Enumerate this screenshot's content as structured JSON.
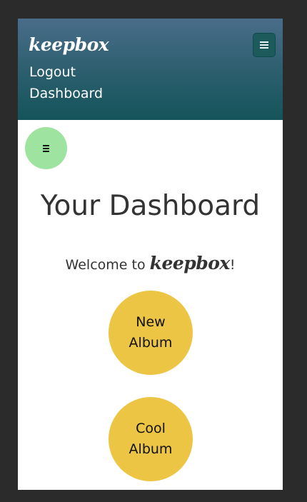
{
  "navbar": {
    "brand": "keepbox",
    "toggle_icon": "hamburger-icon",
    "links": [
      "Logout",
      "Dashboard"
    ]
  },
  "sidebar_toggle": {
    "icon": "hamburger-icon"
  },
  "main": {
    "title": "Your Dashboard",
    "welcome_prefix": "Welcome to ",
    "welcome_brand": "keepbox",
    "welcome_suffix": "!",
    "albums": [
      "New Album",
      "Cool Album"
    ]
  },
  "colors": {
    "navbar_top": "#4a6d8a",
    "navbar_bottom": "#14545a",
    "sidebar_toggle": "#9ee39f",
    "album": "#ecc544"
  }
}
